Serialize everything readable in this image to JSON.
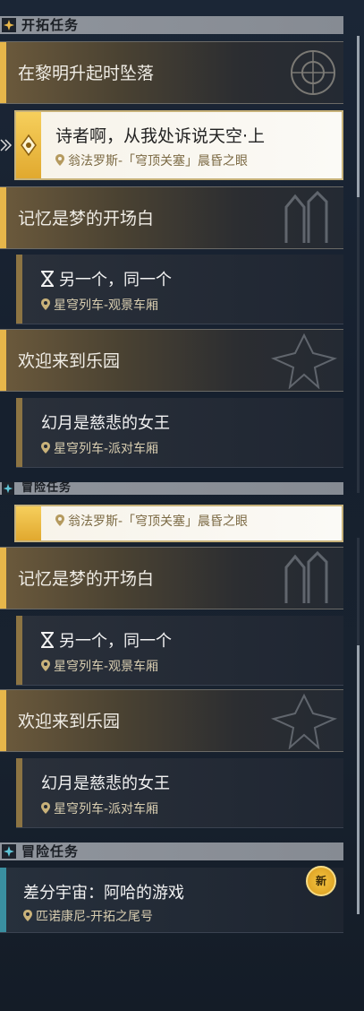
{
  "upper": {
    "section_label": "开拓任务",
    "mission1_title": "在黎明升起时坠落",
    "selected": {
      "title": "诗者啊，从我处诉说天空·上",
      "location": "翁法罗斯-「穹顶关塞」晨昏之眼"
    },
    "mission2_title": "记忆是梦的开场白",
    "quest2": {
      "title": "另一个，同一个",
      "location": "星穹列车-观景车厢"
    },
    "mission3_title": "欢迎来到乐园",
    "quest3": {
      "title": "幻月是慈悲的女王",
      "location": "星穹列车-派对车厢"
    },
    "next_section_label": "冒险任务"
  },
  "lower": {
    "selected_location": "翁法罗斯-「穹顶关塞」晨昏之眼",
    "mission2_title": "记忆是梦的开场白",
    "quest2": {
      "title": "另一个，同一个",
      "location": "星穹列车-观景车厢"
    },
    "mission3_title": "欢迎来到乐园",
    "quest3": {
      "title": "幻月是慈悲的女王",
      "location": "星穹列车-派对车厢"
    },
    "adventure_section_label": "冒险任务",
    "adventure": {
      "title": "差分宇宙：阿哈的游戏",
      "location": "匹诺康尼-开拓之尾号",
      "badge": "新"
    }
  },
  "colors": {
    "accent_gold": "#e7b64a",
    "adventure_teal": "#3a8fa0"
  }
}
